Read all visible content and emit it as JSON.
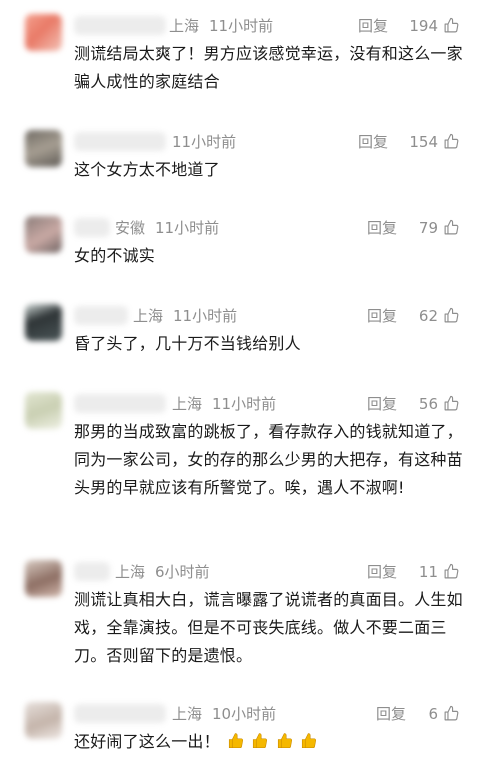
{
  "reply_label": "回复",
  "comments": [
    {
      "location": "上海",
      "time": "11小时前",
      "likes": "194",
      "text": "测谎结局太爽了！男方应该感觉幸运，没有和这么一家骗人成性的家庭结合"
    },
    {
      "location": "",
      "time": "11小时前",
      "likes": "154",
      "text": "这个女方太不地道了"
    },
    {
      "location": "安徽",
      "time": "11小时前",
      "likes": "79",
      "text": "女的不诚实"
    },
    {
      "location": "上海",
      "time": "11小时前",
      "likes": "62",
      "text": "昏了头了，几十万不当钱给别人"
    },
    {
      "location": "上海",
      "time": "11小时前",
      "likes": "56",
      "text": " 那男的当成致富的跳板了，看存款存入的钱就知道了，同为一家公司，女的存的那么少男的大把存，有这种苗头男的早就应该有所警觉了。唉，遇人不淑啊!"
    },
    {
      "location": "上海",
      "time": "6小时前",
      "likes": "11",
      "text": "测谎让真相大白，谎言曝露了说谎者的真面目。人生如戏，全靠演技。但是不可丧失底线。做人不要二面三刀。否则留下的是遗恨。"
    },
    {
      "location": "上海",
      "time": "10小时前",
      "likes": "6",
      "text": "还好闹了这么一出！"
    }
  ],
  "colors": {
    "meta": "#8e8e8e",
    "text": "#1a1a1a",
    "emoji": "#f5b800"
  },
  "icons": {
    "like": "thumbs-up-icon",
    "emoji": "thumbs-up-emoji"
  }
}
